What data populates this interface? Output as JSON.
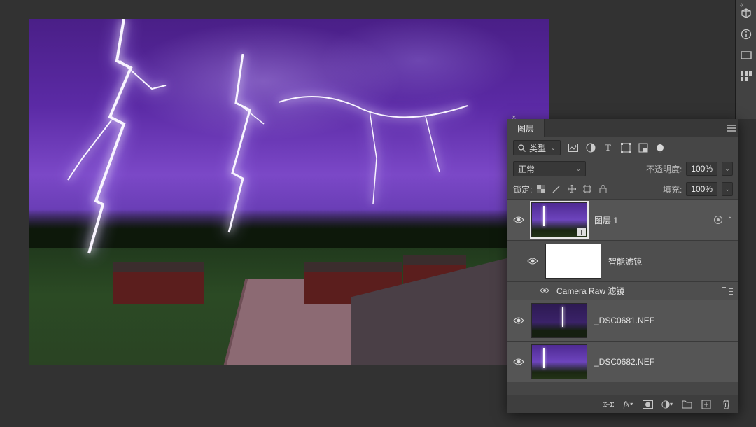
{
  "panel": {
    "tab_label": "图层",
    "kind_label": "类型",
    "blend_mode": "正常",
    "opacity_label": "不透明度:",
    "opacity_value": "100%",
    "lock_label": "锁定:",
    "fill_label": "填充:",
    "fill_value": "100%"
  },
  "layers": [
    {
      "name": "图层 1",
      "selected": true,
      "smart": true
    },
    {
      "name": "智能滤镜",
      "child": true,
      "white": true
    },
    {
      "filter_name": "Camera Raw 滤镜"
    },
    {
      "name": "_DSC0681.NEF"
    },
    {
      "name": "_DSC0682.NEF"
    }
  ]
}
